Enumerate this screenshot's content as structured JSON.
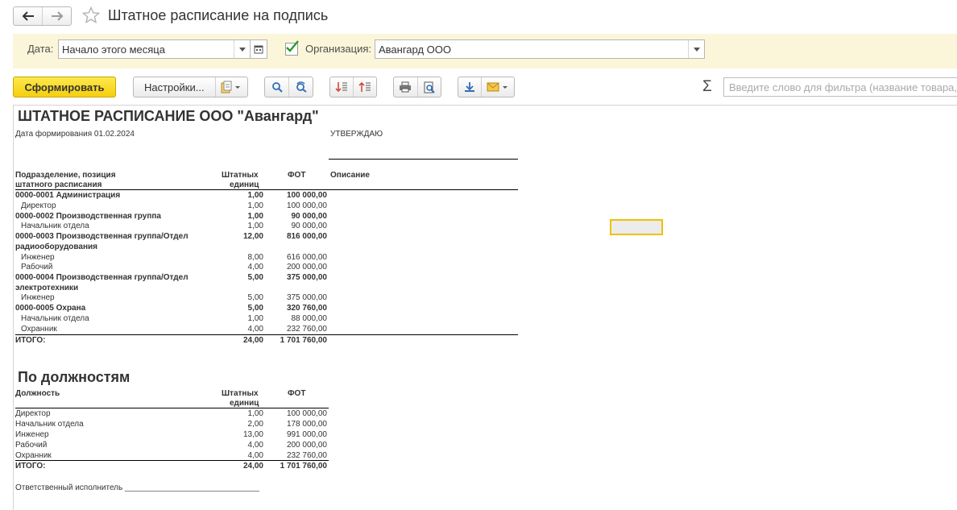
{
  "window": {
    "title": "Штатное расписание на подпись"
  },
  "params": {
    "date_label": "Дата:",
    "date_value": "Начало этого месяца",
    "org_checked": true,
    "org_label": "Организация:",
    "org_value": "Авангард ООО"
  },
  "toolbar": {
    "generate_label": "Сформировать",
    "settings_label": "Настройки...",
    "sum_symbol": "Σ",
    "filter_placeholder": "Введите слово для фильтра (название товара, п"
  },
  "report": {
    "title": "ШТАТНОЕ РАСПИСАНИЕ ООО \"Авангард\"",
    "date_line": "Дата формирования 01.02.2024",
    "approve": "УТВЕРЖДАЮ",
    "headers": {
      "position_1": "Подразделение, позиция",
      "position_2": "штатного расписания",
      "units_1": "Штатных",
      "units_2": "единиц",
      "payroll": "ФОТ",
      "desc": "Описание"
    },
    "rows": [
      {
        "name": "0000-0001 Администрация",
        "units": "1,00",
        "payroll": "100 000,00",
        "bold": true
      },
      {
        "name": "Директор",
        "units": "1,00",
        "payroll": "100 000,00",
        "bold": false
      },
      {
        "name": "0000-0002 Производственная группа",
        "units": "1,00",
        "payroll": "90 000,00",
        "bold": true
      },
      {
        "name": "Начальник отдела",
        "units": "1,00",
        "payroll": "90 000,00",
        "bold": false
      },
      {
        "name": "0000-0003 Производственная группа/Отдел",
        "name2": "радиооборудования",
        "units": "12,00",
        "payroll": "816 000,00",
        "bold": true
      },
      {
        "name": "Инженер",
        "units": "8,00",
        "payroll": "616 000,00",
        "bold": false
      },
      {
        "name": "Рабочий",
        "units": "4,00",
        "payroll": "200 000,00",
        "bold": false
      },
      {
        "name": "0000-0004 Производственная группа/Отдел",
        "name2": "электротехники",
        "units": "5,00",
        "payroll": "375 000,00",
        "bold": true
      },
      {
        "name": "Инженер",
        "units": "5,00",
        "payroll": "375 000,00",
        "bold": false
      },
      {
        "name": "0000-0005 Охрана",
        "units": "5,00",
        "payroll": "320 760,00",
        "bold": true
      },
      {
        "name": "Начальник отдела",
        "units": "1,00",
        "payroll": "88 000,00",
        "bold": false
      },
      {
        "name": "Охранник",
        "units": "4,00",
        "payroll": "232 760,00",
        "bold": false
      }
    ],
    "total": {
      "label": "ИТОГО:",
      "units": "24,00",
      "payroll": "1 701 760,00"
    },
    "section2": {
      "title": "По должностям",
      "headers": {
        "position": "Должность",
        "units_1": "Штатных",
        "units_2": "единиц",
        "payroll": "ФОТ"
      },
      "rows": [
        {
          "name": "Директор",
          "units": "1,00",
          "payroll": "100 000,00"
        },
        {
          "name": "Начальник отдела",
          "units": "2,00",
          "payroll": "178 000,00"
        },
        {
          "name": "Инженер",
          "units": "13,00",
          "payroll": "991 000,00"
        },
        {
          "name": "Рабочий",
          "units": "4,00",
          "payroll": "200 000,00"
        },
        {
          "name": "Охранник",
          "units": "4,00",
          "payroll": "232 760,00"
        }
      ],
      "total": {
        "label": "ИТОГО:",
        "units": "24,00",
        "payroll": "1 701 760,00"
      }
    },
    "signature": "Ответственный исполнитель ______________________________"
  }
}
